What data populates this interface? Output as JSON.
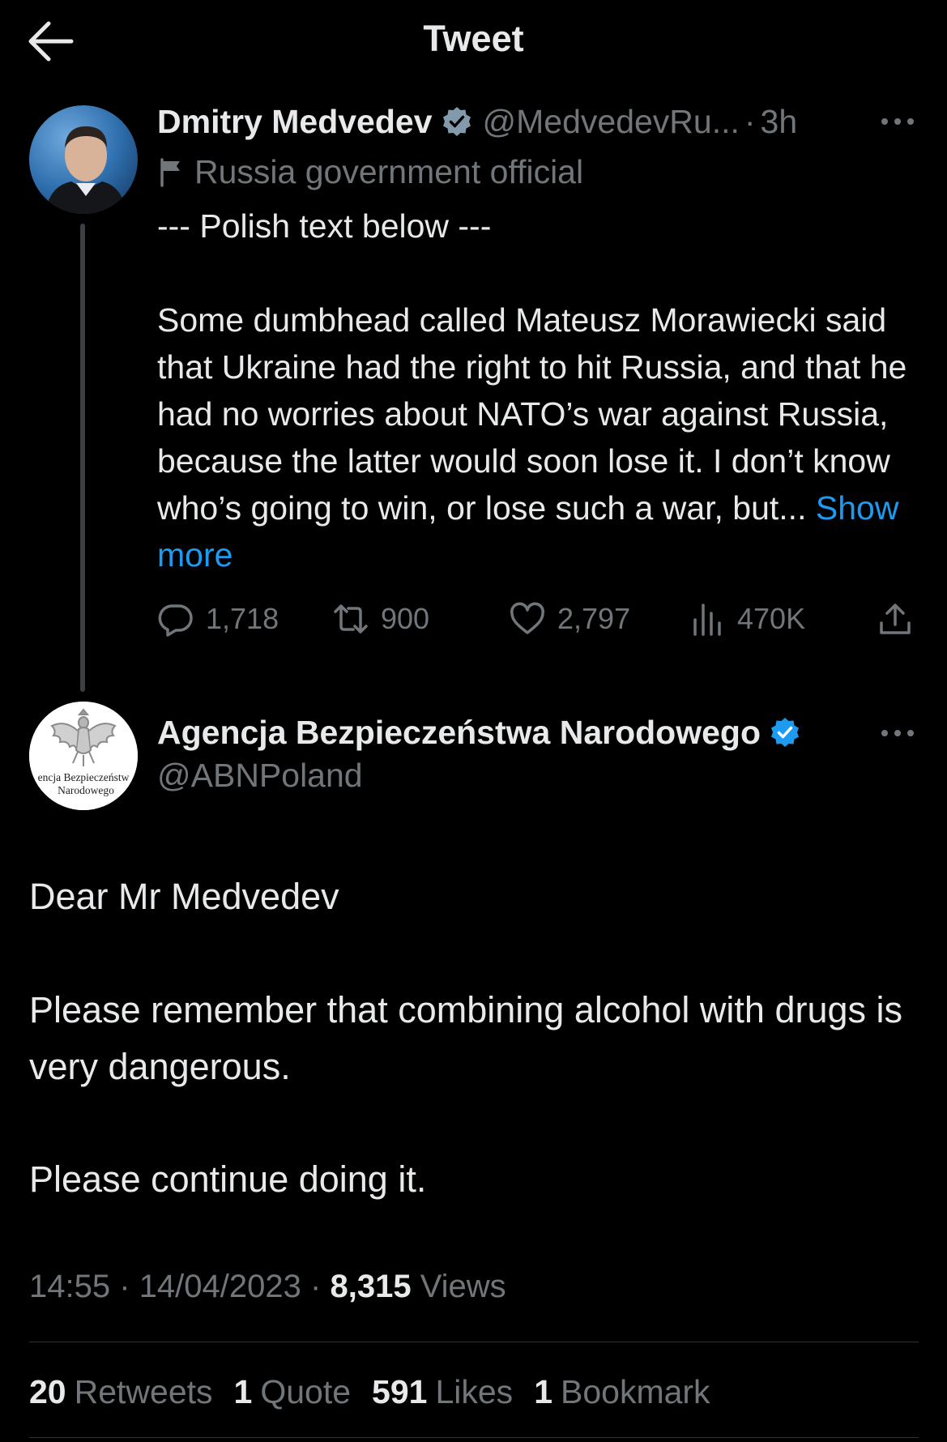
{
  "header": {
    "title": "Tweet"
  },
  "parent_tweet": {
    "display_name": "Dmitry Medvedev",
    "handle": "@MedvedevRu...",
    "separator": "·",
    "time": "3h",
    "label": "Russia government official",
    "intro": "--- Polish text below ---",
    "body": "Some dumbhead called Mateusz Morawiecki said that Ukraine had the right to hit Russia, and that he had no worries about NATO’s war against Russia, because the latter would soon lose it. I don’t know who’s going to win, or lose such a war, but...",
    "show_more": "Show more",
    "counts": {
      "replies": "1,718",
      "retweets": "900",
      "likes": "2,797",
      "views": "470K"
    }
  },
  "reply_tweet": {
    "display_name": "Agencja Bezpieczeństwa Narodowego",
    "handle": "@ABNPoland",
    "avatar_caption": {
      "line1": "encja Bezpieczeństw",
      "line2": "Narodowego"
    },
    "paragraphs": [
      "Dear Mr Medvedev",
      "Please remember that combining alcohol with drugs is very dangerous.",
      "Please continue doing it."
    ],
    "time": "14:55",
    "date": "14/04/2023",
    "separator": "·",
    "views_count": "8,315",
    "views_label": "Views",
    "stats": {
      "retweets_count": "20",
      "retweets_label": "Retweets",
      "quotes_count": "1",
      "quotes_label": "Quote",
      "likes_count": "591",
      "likes_label": "Likes",
      "bookmarks_count": "1",
      "bookmarks_label": "Bookmark"
    }
  },
  "colors": {
    "background": "#000000",
    "text_primary": "#e7e9ea",
    "text_secondary": "#71767b",
    "accent": "#1d9bf0",
    "verified_blue": "#1d9bf0",
    "verified_gray": "#829aab",
    "divider": "#2f3336"
  },
  "icons": [
    "back-arrow-icon",
    "verified-badge-icon",
    "flag-icon",
    "more-icon",
    "reply-icon",
    "retweet-icon",
    "like-icon",
    "views-icon",
    "share-icon"
  ]
}
